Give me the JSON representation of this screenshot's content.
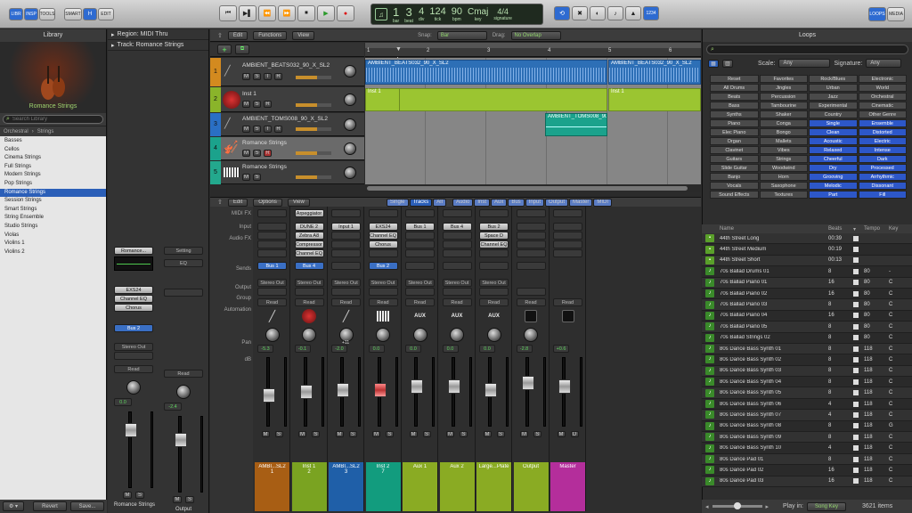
{
  "toolbar": {
    "left_buttons": [
      "LIBR",
      "INSP",
      "TOOLS"
    ],
    "smart": "SMART",
    "h": "H",
    "edit": "EDIT",
    "lcd": {
      "bar": "1",
      "beat": "3",
      "div": "4",
      "tick": "124",
      "bpm": "90",
      "key": "Cmaj",
      "signature": "4/4",
      "bar_l": "bar",
      "beat_l": "beat",
      "div_l": "div",
      "tick_l": "tick",
      "bpm_l": "bpm",
      "key_l": "key",
      "sig_l": "signature"
    },
    "right_buttons": [
      "LOOPS",
      "MEDIA"
    ],
    "num_1234": "1234"
  },
  "library": {
    "title": "Library",
    "patch": "Romance Strings",
    "search_placeholder": "Search Library",
    "path": [
      "Orchestral",
      "Strings"
    ],
    "items": [
      "Basses",
      "Cellos",
      "Cinema Strings",
      "Full Strings",
      "Modern Strings",
      "Pop Strings",
      "Romance Strings",
      "Session Strings",
      "Smart Strings",
      "String Ensemble",
      "Studio Strings",
      "Violas",
      "Violins 1",
      "Violins 2"
    ],
    "selected": 6,
    "revert": "Revert",
    "save": "Save..."
  },
  "inspector": {
    "region": "Region: MIDI Thru",
    "track": "Track: Romance Strings",
    "strip1": {
      "setting": "Romance...",
      "eq": "EQ",
      "inst": "EXS24",
      "fx": [
        "Channel EQ",
        "Chorus"
      ],
      "send": "Bus 2",
      "out": "Stereo Out",
      "auto": "Read",
      "db": "0.0",
      "m": "M",
      "s": "S",
      "name": "Romance Strings"
    },
    "strip2": {
      "setting": "Setting",
      "eq": "EQ",
      "auto": "Read",
      "db": "-2.4",
      "m": "M",
      "s": "S",
      "name": "Output"
    }
  },
  "tracks": {
    "edit": "Edit",
    "functions": "Functions",
    "view": "View",
    "list": [
      {
        "num": "1",
        "name": "AMBIENT_BEATS032_90_X_SL2",
        "color": "#d38a1f"
      },
      {
        "num": "2",
        "name": "Inst 1",
        "color": "#8ab42a"
      },
      {
        "num": "3",
        "name": "AMBIENT_TOMS008_90_X_SL2",
        "color": "#2a6fc4"
      },
      {
        "num": "4",
        "name": "Romance Strings",
        "color": "#1ba28c"
      },
      {
        "num": "5",
        "name": "Romance Strings",
        "color": "#23a88d"
      }
    ],
    "ruler": [
      "1",
      "2",
      "3",
      "4",
      "5",
      "6"
    ],
    "snap_label": "Snap:",
    "snap": "Bar",
    "drag_label": "Drag:",
    "drag": "No Overlap",
    "regions": {
      "beats_a": "AMBIENT_BEATS032_90_X_SL2",
      "beats_b": "AMBIENT_BEATS032_90_X_SL2",
      "inst_a": "Inst 1",
      "inst_b": "Inst 1",
      "toms": "AMBIENT_TOMS008_90"
    }
  },
  "mixer": {
    "edit": "Edit",
    "options": "Options",
    "view": "View",
    "filters": [
      "Single",
      "Tracks",
      "All",
      "Audio",
      "Inst",
      "Aux",
      "Bus",
      "Input",
      "Output",
      "Master",
      "MIDI"
    ],
    "row_labels": [
      "MIDI FX",
      "Input",
      "Audio FX",
      "Sends",
      "Output",
      "Group",
      "Automation",
      "Pan",
      "dB"
    ],
    "strips": [
      {
        "midifx": "",
        "input": "",
        "fx": [],
        "send": "Bus 1",
        "out": "Stereo Out",
        "auto": "Read",
        "db": "-5.3",
        "name": "AMBI...SL2",
        "num": "1",
        "color": "#a85e14"
      },
      {
        "midifx": "Arpeggiator",
        "input": "DUNE 2",
        "fx": [
          "Zebra A8",
          "Compressor",
          "Channel EQ"
        ],
        "send": "Bus 4",
        "out": "Stereo Out",
        "auto": "Read",
        "db": "-0.1",
        "name": "Inst 1",
        "num": "2",
        "color": "#7aa321"
      },
      {
        "midifx": "",
        "input": "Input 1",
        "fx": [],
        "send": "",
        "out": "Stereo Out",
        "auto": "Read",
        "db": "-2.0",
        "name": "AMBI...SL2",
        "num": "3",
        "color": "#1f5fa8"
      },
      {
        "midifx": "",
        "input": "EXS24",
        "fx": [
          "Channel EQ",
          "Chorus"
        ],
        "send": "Bus 2",
        "out": "Stereo Out",
        "auto": "Read",
        "db": "0.0",
        "name": "Inst 2",
        "num": "7",
        "color": "#129c7e"
      },
      {
        "midifx": "",
        "input": "Bus 1",
        "fx": [],
        "send": "",
        "out": "Stereo Out",
        "auto": "Read",
        "db": "0.0",
        "name": "Aux 1",
        "num": "",
        "color": "#8aab23"
      },
      {
        "midifx": "",
        "input": "Bus 4",
        "fx": [],
        "send": "",
        "out": "Stereo Out",
        "auto": "Read",
        "db": "0.0",
        "name": "Aux 2",
        "num": "",
        "color": "#8aab23"
      },
      {
        "midifx": "",
        "input": "Bus 2",
        "fx": [
          "Space D",
          "Channel EQ"
        ],
        "send": "",
        "out": "Stereo Out",
        "auto": "Read",
        "db": "0.0",
        "name": "Large...Plate",
        "num": "",
        "color": "#8aab23"
      },
      {
        "midifx": "",
        "input": "",
        "fx": [],
        "send": "",
        "out": "",
        "auto": "Read",
        "db": "-2.8",
        "name": "Output",
        "num": "",
        "color": "#8aab23"
      },
      {
        "midifx": "",
        "input": "",
        "fx": [],
        "send": "",
        "out": "",
        "auto": "Read",
        "db": "+0.6",
        "name": "Master",
        "num": "",
        "color": "#b42e9b"
      }
    ],
    "aux_label": "AUX",
    "pan_value": "+11"
  },
  "loops": {
    "title": "Loops",
    "scale_label": "Scale:",
    "scale": "Any",
    "sig_label": "Signature:",
    "sig": "Any",
    "keywords": [
      [
        "Reset",
        "Favorites",
        "Rock/Blues",
        "Electronic"
      ],
      [
        "All Drums",
        "Jingles",
        "Urban",
        "World"
      ],
      [
        "Beats",
        "Percussion",
        "Jazz",
        "Orchestral"
      ],
      [
        "Bass",
        "Tambourine",
        "Experimental",
        "Cinematic"
      ],
      [
        "Synths",
        "Shaker",
        "Country",
        "Other Genre"
      ],
      [
        "Piano",
        "Conga",
        "Single",
        "Ensemble"
      ],
      [
        "Elec Piano",
        "Bongo",
        "Clean",
        "Distorted"
      ],
      [
        "Organ",
        "Mallets",
        "Acoustic",
        "Electric"
      ],
      [
        "Clavinet",
        "Vibes",
        "Relaxed",
        "Intense"
      ],
      [
        "Guitars",
        "Strings",
        "Cheerful",
        "Dark"
      ],
      [
        "Slide Guitar",
        "Woodwind",
        "Dry",
        "Processed"
      ],
      [
        "Banjo",
        "Horn",
        "Grooving",
        "Arrhythmic"
      ],
      [
        "Vocals",
        "Saxophone",
        "Melodic",
        "Dissonant"
      ],
      [
        "Sound Effects",
        "Textures",
        "Part",
        "Fill"
      ]
    ],
    "columns": [
      "Name",
      "Beats",
      "Tempo",
      "Key"
    ],
    "items": [
      [
        "44th Street Long",
        "00:39",
        "",
        ""
      ],
      [
        "44th Street Medium",
        "00:19",
        "",
        ""
      ],
      [
        "44th Street Short",
        "00:13",
        "",
        ""
      ],
      [
        "70s Ballad Drums 01",
        "8",
        "80",
        "-"
      ],
      [
        "70s Ballad Piano 01",
        "16",
        "80",
        "C"
      ],
      [
        "70s Ballad Piano 02",
        "16",
        "80",
        "C"
      ],
      [
        "70s Ballad Piano 03",
        "8",
        "80",
        "C"
      ],
      [
        "70s Ballad Piano 04",
        "16",
        "80",
        "C"
      ],
      [
        "70s Ballad Piano 05",
        "8",
        "80",
        "C"
      ],
      [
        "70s Ballad Strings 02",
        "8",
        "80",
        "C"
      ],
      [
        "80s Dance Bass Synth 01",
        "8",
        "118",
        "C"
      ],
      [
        "80s Dance Bass Synth 02",
        "8",
        "118",
        "C"
      ],
      [
        "80s Dance Bass Synth 03",
        "8",
        "118",
        "C"
      ],
      [
        "80s Dance Bass Synth 04",
        "8",
        "118",
        "C"
      ],
      [
        "80s Dance Bass Synth 05",
        "8",
        "118",
        "C"
      ],
      [
        "80s Dance Bass Synth 06",
        "4",
        "118",
        "C"
      ],
      [
        "80s Dance Bass Synth 07",
        "4",
        "118",
        "C"
      ],
      [
        "80s Dance Bass Synth 08",
        "8",
        "118",
        "G"
      ],
      [
        "80s Dance Bass Synth 09",
        "8",
        "118",
        "C"
      ],
      [
        "80s Dance Bass Synth 10",
        "4",
        "118",
        "C"
      ],
      [
        "80s Dance Pad 01",
        "8",
        "118",
        "C"
      ],
      [
        "80s Dance Pad 02",
        "16",
        "118",
        "C"
      ],
      [
        "80s Dance Pad 03",
        "16",
        "118",
        "C"
      ]
    ],
    "play_in": "Play in:",
    "song_key": "Song Key",
    "count": "3621 items"
  }
}
